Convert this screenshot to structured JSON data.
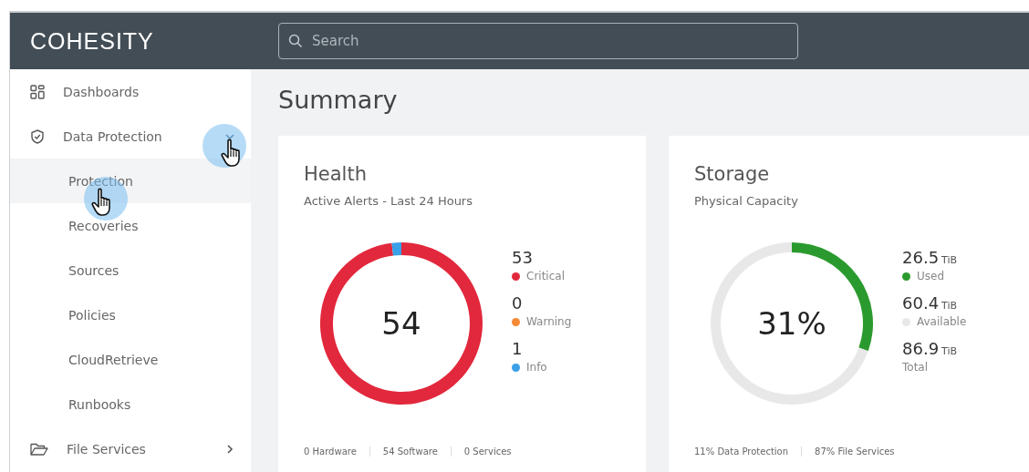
{
  "header": {
    "logo": "COHESITY",
    "search": {
      "placeholder": "Search"
    }
  },
  "sidebar": {
    "items": [
      {
        "label": "Dashboards",
        "selected": false
      },
      {
        "label": "Data Protection",
        "selected": false,
        "expanded": true,
        "children": [
          {
            "label": "Protection",
            "selected": true
          },
          {
            "label": "Recoveries",
            "selected": false
          },
          {
            "label": "Sources",
            "selected": false
          },
          {
            "label": "Policies",
            "selected": false
          },
          {
            "label": "CloudRetrieve",
            "selected": false
          },
          {
            "label": "Runbooks",
            "selected": false
          }
        ]
      },
      {
        "label": "File Services",
        "selected": false,
        "expanded": false
      }
    ]
  },
  "page_title": "Summary",
  "cards": [
    {
      "title": "Health",
      "center_label": "54",
      "chart_data": {
        "type": "donut",
        "categories": [
          "Critical",
          "Warning",
          "Info"
        ],
        "series": [
          {
            "name": "Active Alerts - Last 24 Hours",
            "values": [
              98.1,
              0,
              1.9
            ]
          }
        ],
        "legend": "right"
      },
      "legend": [
        {
          "value": "53",
          "color": "#e2283c"
        },
        {
          "value": "0",
          "color": "#f58a34"
        },
        {
          "value": "1",
          "color": "#3aa0e8"
        }
      ],
      "footer": [
        "0 Hardware",
        "54 Software",
        "0 Services"
      ]
    },
    {
      "title": "Storage",
      "center_label": "31%",
      "chart_data": {
        "type": "donut",
        "categories": [
          "Used",
          "Available"
        ],
        "series": [
          {
            "name": "Physical Capacity",
            "values": [
              30.5,
              69.5
            ]
          }
        ],
        "legend": "right"
      },
      "legend": [
        {
          "value": "26.5",
          "unit": "TiB",
          "color": "#2b9a2e"
        },
        {
          "value": "60.4",
          "unit": "TiB",
          "color": "#e8e8e8"
        },
        {
          "value": "86.9",
          "unit": "TiB",
          "label": "Total"
        }
      ],
      "footer": [
        "11% Data Protection",
        "87% File Services"
      ]
    }
  ]
}
